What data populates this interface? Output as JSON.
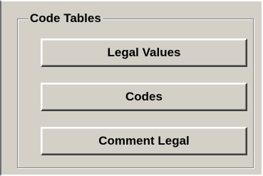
{
  "group": {
    "title": "Code Tables"
  },
  "buttons": {
    "legal_values": "Legal Values",
    "codes": "Codes",
    "comment_legal": "Comment Legal"
  },
  "colors": {
    "face": "#d4d0c8",
    "text": "#000000"
  }
}
